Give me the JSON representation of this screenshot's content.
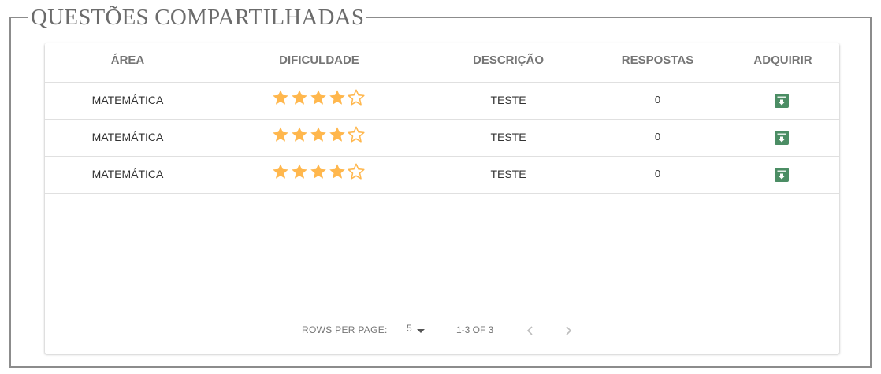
{
  "panel": {
    "title": "QUESTÕES COMPARTILHADAS"
  },
  "table": {
    "headers": {
      "area": "ÁREA",
      "dificuldade": "DIFICULDADE",
      "descricao": "DESCRIÇÃO",
      "respostas": "RESPOSTAS",
      "adquirir": "ADQUIRIR"
    },
    "rows": [
      {
        "area": "MATEMÁTICA",
        "rating": 4,
        "rating_max": 5,
        "descricao": "TESTE",
        "respostas": "0",
        "action_icon": "download-icon"
      },
      {
        "area": "MATEMÁTICA",
        "rating": 4,
        "rating_max": 5,
        "descricao": "TESTE",
        "respostas": "0",
        "action_icon": "download-icon"
      },
      {
        "area": "MATEMÁTICA",
        "rating": 4,
        "rating_max": 5,
        "descricao": "TESTE",
        "respostas": "0",
        "action_icon": "download-icon"
      }
    ]
  },
  "pagination": {
    "rows_per_page_label": "ROWS PER PAGE:",
    "rows_per_page_value": "5",
    "range_text": "1-3 OF 3"
  },
  "colors": {
    "star": "#ffb74d",
    "action_button": "#4b8d64",
    "border": "#8c8c8c",
    "divider": "#e0e0e0"
  }
}
